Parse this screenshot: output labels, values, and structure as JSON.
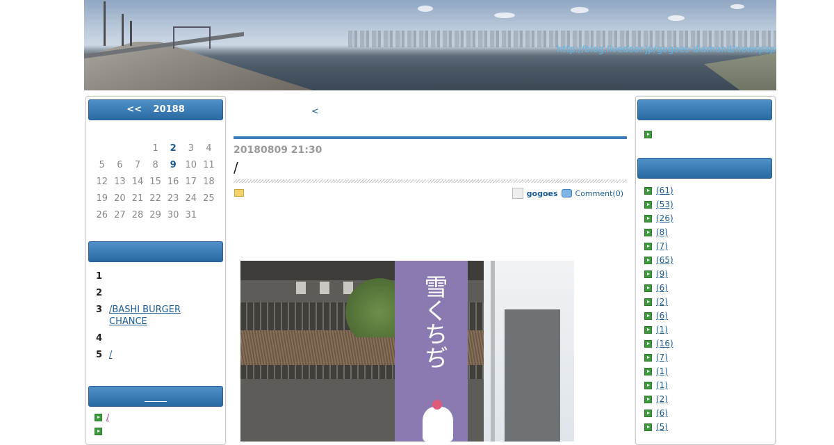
{
  "header": {
    "blog_url": "http://blog.livedoor.jp/gogoes-diamond/newspaper/"
  },
  "calendar": {
    "prev_label": "<<",
    "month_label": "20188",
    "weeks": [
      [
        "",
        "",
        "",
        "1",
        "2",
        "3",
        "4"
      ],
      [
        "5",
        "6",
        "7",
        "8",
        "9",
        "10",
        "11"
      ],
      [
        "12",
        "13",
        "14",
        "15",
        "16",
        "17",
        "18"
      ],
      [
        "19",
        "20",
        "21",
        "22",
        "23",
        "24",
        "25"
      ],
      [
        "26",
        "27",
        "28",
        "29",
        "30",
        "31",
        ""
      ]
    ],
    "linked_days": [
      "2",
      "9"
    ]
  },
  "ranking": {
    "title": "",
    "items": [
      {
        "num": "1",
        "label": ""
      },
      {
        "num": "2",
        "label": ""
      },
      {
        "num": "3",
        "label": "/BASHI BURGER CHANCE"
      },
      {
        "num": "4",
        "label": ""
      },
      {
        "num": "5",
        "label": "/"
      }
    ]
  },
  "left_category": {
    "title": "",
    "items": [
      {
        "label": "/"
      },
      {
        "label": ""
      }
    ]
  },
  "post": {
    "prev_link": "<",
    "datetime": "20180809 21:30",
    "title": "/",
    "author": "gogoes",
    "comments": "Comment(0)"
  },
  "right_sidebar": {
    "box1_title": "",
    "box1_items": [
      ""
    ],
    "box2_title": "",
    "categories": [
      {
        "count": "(61)"
      },
      {
        "count": "(53)"
      },
      {
        "count": "(26)"
      },
      {
        "count": "(8)"
      },
      {
        "count": "(7)"
      },
      {
        "count": "(65)"
      },
      {
        "count": "(9)"
      },
      {
        "count": "(6)"
      },
      {
        "count": "(2)"
      },
      {
        "count": "(6)"
      },
      {
        "count": "(1)"
      },
      {
        "count": "(16)"
      },
      {
        "count": "(7)"
      },
      {
        "count": "(1)"
      },
      {
        "count": "(1)"
      },
      {
        "count": "(2)"
      },
      {
        "count": "(6)"
      },
      {
        "count": "(5)"
      }
    ]
  },
  "photo": {
    "banner_text": "雪くちぢ"
  },
  "colors": {
    "accent": "#3f7db8",
    "link": "#1a5b96",
    "bullet": "#3c9a3c"
  }
}
